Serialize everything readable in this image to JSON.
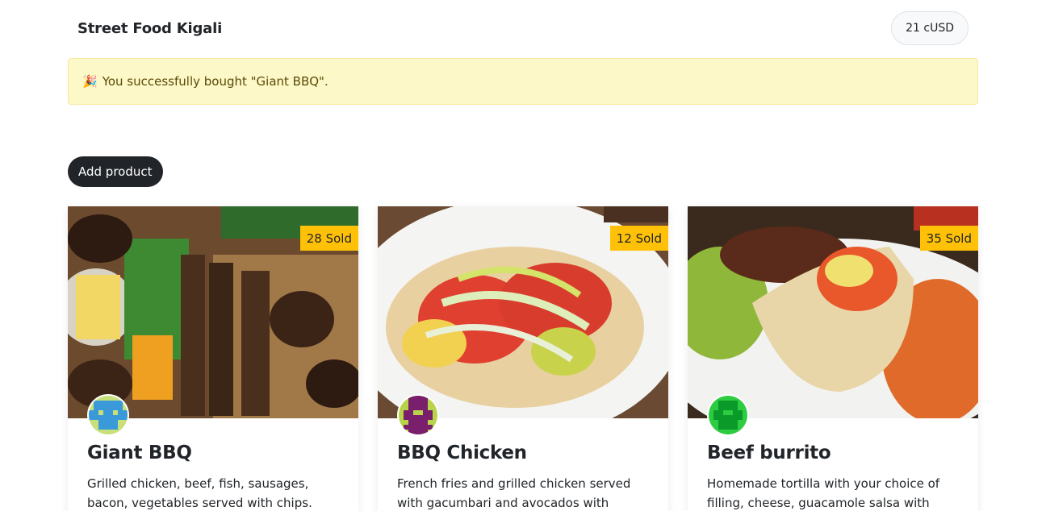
{
  "header": {
    "brand": "Street Food Kigali",
    "balance": "21 cUSD"
  },
  "alert": {
    "icon": "party-popper-icon",
    "emoji": "🎉",
    "message": "You successfully bought \"Giant BBQ\"."
  },
  "actions": {
    "add_product_label": "Add product"
  },
  "products": [
    {
      "name": "Giant BBQ",
      "sold": "28 Sold",
      "description": "Grilled chicken, beef, fish, sausages, bacon, vegetables served with chips.",
      "avatar_colors": [
        "#c8e07a",
        "#3a9ad9"
      ]
    },
    {
      "name": "BBQ Chicken",
      "sold": "12 Sold",
      "description": "French fries and grilled chicken served with gacumbari and avocados with",
      "avatar_colors": [
        "#b8d44a",
        "#7a1f6b"
      ]
    },
    {
      "name": "Beef burrito",
      "sold": "35 Sold",
      "description": "Homemade tortilla with your choice of filling, cheese, guacamole salsa with",
      "avatar_colors": [
        "#2ecc40",
        "#0a9a2a"
      ]
    }
  ],
  "colors": {
    "accent_badge": "#ffc107",
    "alert_bg": "#fcf8c8",
    "button_dark": "#212529"
  }
}
